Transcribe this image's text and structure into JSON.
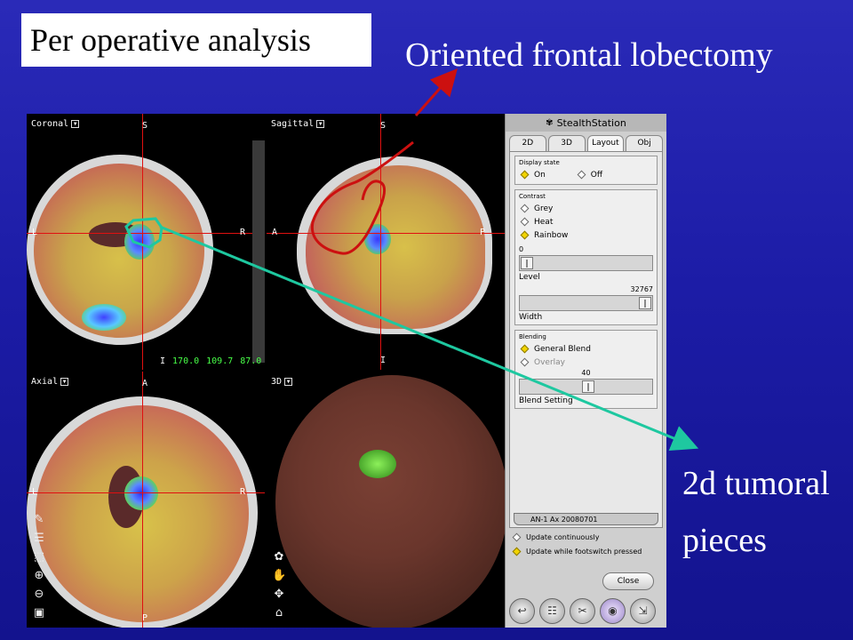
{
  "slide": {
    "title": "Per operative analysis",
    "callout_top": "Oriented frontal lobectomy",
    "callout_bottom_line1": "2d tumoral",
    "callout_bottom_line2": "pieces"
  },
  "viewports": {
    "coronal": {
      "label": "Coronal",
      "top": "S",
      "left": "L",
      "right": "R",
      "bottom": "I",
      "coords": [
        "170.0",
        "109.7",
        "87.0"
      ]
    },
    "sagittal": {
      "label": "Sagittal",
      "top": "S",
      "left": "A",
      "right": "P",
      "bottom": "I"
    },
    "axial": {
      "label": "Axial",
      "top": "A",
      "left": "L",
      "right": "R",
      "bottom": "P"
    },
    "three_d": {
      "label": "3D"
    }
  },
  "panel": {
    "app_title": "StealthStation",
    "tabs": [
      "2D",
      "3D",
      "Layout",
      "Obj"
    ],
    "display_state": {
      "title": "Display state",
      "on": "On",
      "off": "Off"
    },
    "contrast": {
      "title": "Contrast",
      "options": [
        "Grey",
        "Heat",
        "Rainbow"
      ]
    },
    "level": {
      "value": "0",
      "caption": "Level"
    },
    "width": {
      "value": "32767",
      "caption": "Width"
    },
    "blending": {
      "title": "Blending",
      "general": "General Blend",
      "overlay": "Overlay"
    },
    "blend_setting": {
      "value": "40",
      "caption": "Blend Setting"
    },
    "dataset_tab": "AN-1 Ax 20080701",
    "update_continuously": "Update continuously",
    "update_footswitch": "Update while footswitch pressed",
    "close_label": "Close"
  },
  "colors": {
    "arrow_red": "#cc1010",
    "arrow_teal": "#1ec8a0",
    "crosshair": "#e01010"
  }
}
